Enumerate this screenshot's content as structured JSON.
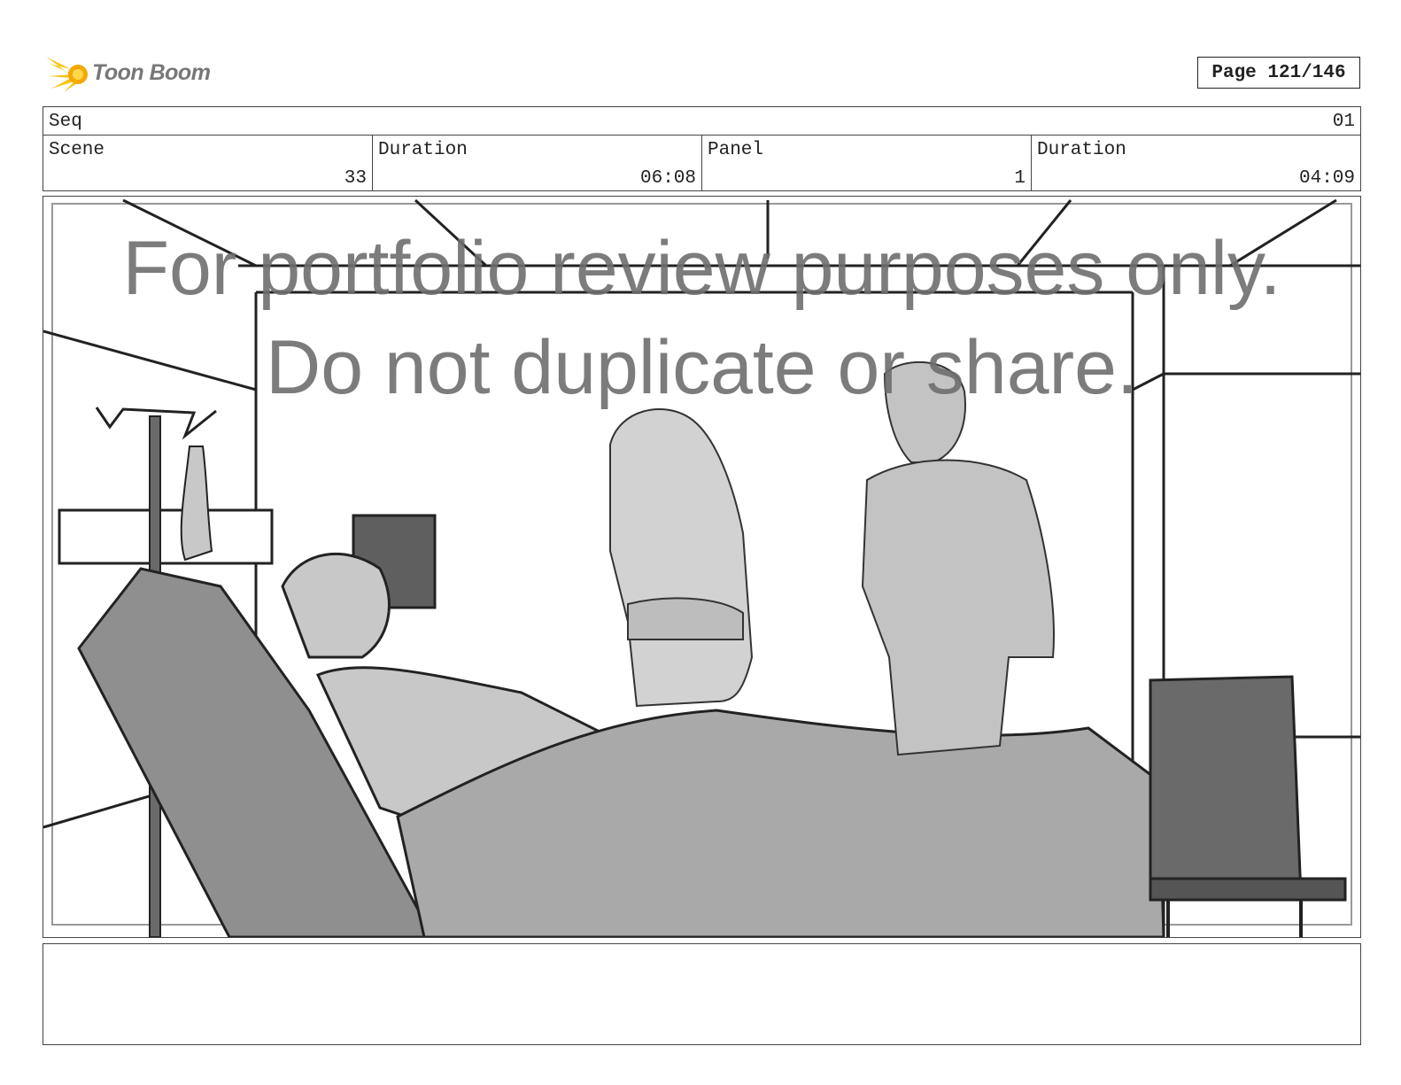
{
  "header": {
    "logo_text": "Toon Boom",
    "page_label": "Page 121/146"
  },
  "info": {
    "seq_label": "Seq",
    "seq_value": "01",
    "scene_label": "Scene",
    "scene_value": "33",
    "scene_duration_label": "Duration",
    "scene_duration_value": "06:08",
    "panel_label": "Panel",
    "panel_value": "1",
    "panel_duration_label": "Duration",
    "panel_duration_value": "04:09"
  },
  "panel": {
    "watermark_line1": "For portfolio review purposes only.",
    "watermark_line2": "Do not duplicate or share."
  },
  "notes": {
    "text": ""
  },
  "colors": {
    "logo_accent": "#f5c518",
    "logo_text": "#777777",
    "border": "#444444",
    "sketch_dark": "#222222",
    "sketch_mid": "#8f8f8f",
    "sketch_light": "#c8c8c8"
  }
}
